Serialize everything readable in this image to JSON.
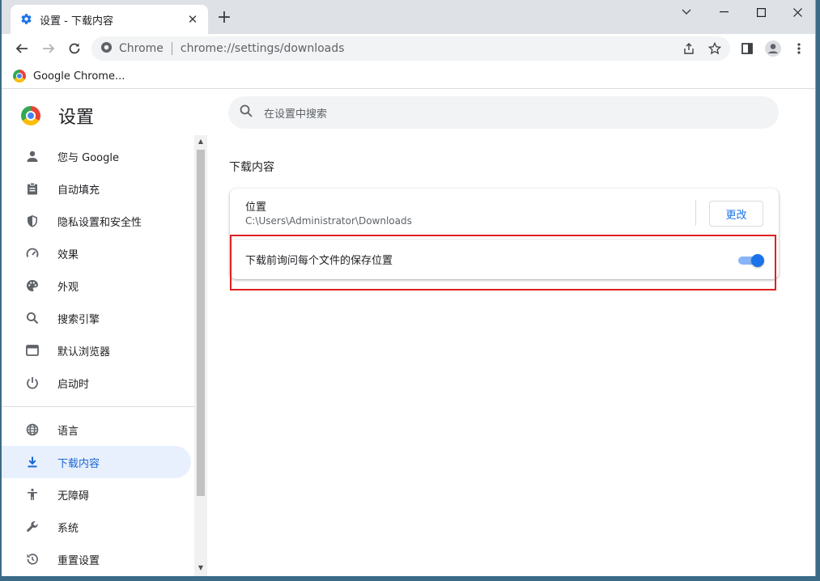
{
  "tab": {
    "title": "设置 - 下载内容",
    "close": "✕",
    "newtab": "+"
  },
  "toolbar": {
    "site": "Chrome",
    "url": "chrome://settings/downloads"
  },
  "bookmarks": [
    {
      "label": "Google Chrome..."
    }
  ],
  "page": {
    "title": "设置",
    "search_placeholder": "在设置中搜索"
  },
  "sidebar": {
    "items": [
      {
        "label": "您与 Google",
        "icon": "person-icon"
      },
      {
        "label": "自动填充",
        "icon": "clipboard-icon"
      },
      {
        "label": "隐私设置和安全性",
        "icon": "shield-icon"
      },
      {
        "label": "效果",
        "icon": "speedometer-icon"
      },
      {
        "label": "外观",
        "icon": "palette-icon"
      },
      {
        "label": "搜索引擎",
        "icon": "search-icon"
      },
      {
        "label": "默认浏览器",
        "icon": "browser-icon"
      },
      {
        "label": "启动时",
        "icon": "power-icon"
      },
      {
        "label": "语言",
        "icon": "globe-icon"
      },
      {
        "label": "下载内容",
        "icon": "download-icon",
        "active": true
      },
      {
        "label": "无障碍",
        "icon": "accessibility-icon"
      },
      {
        "label": "系统",
        "icon": "wrench-icon"
      },
      {
        "label": "重置设置",
        "icon": "reset-icon"
      }
    ]
  },
  "downloads": {
    "section_title": "下载内容",
    "location_label": "位置",
    "location_path": "C:\\Users\\Administrator\\Downloads",
    "change_button": "更改",
    "ask_label": "下载前询问每个文件的保存位置",
    "ask_enabled": true
  },
  "colors": {
    "accent": "#1a73e8",
    "highlight": "#e02020",
    "active_bg": "#e8f0fe"
  }
}
